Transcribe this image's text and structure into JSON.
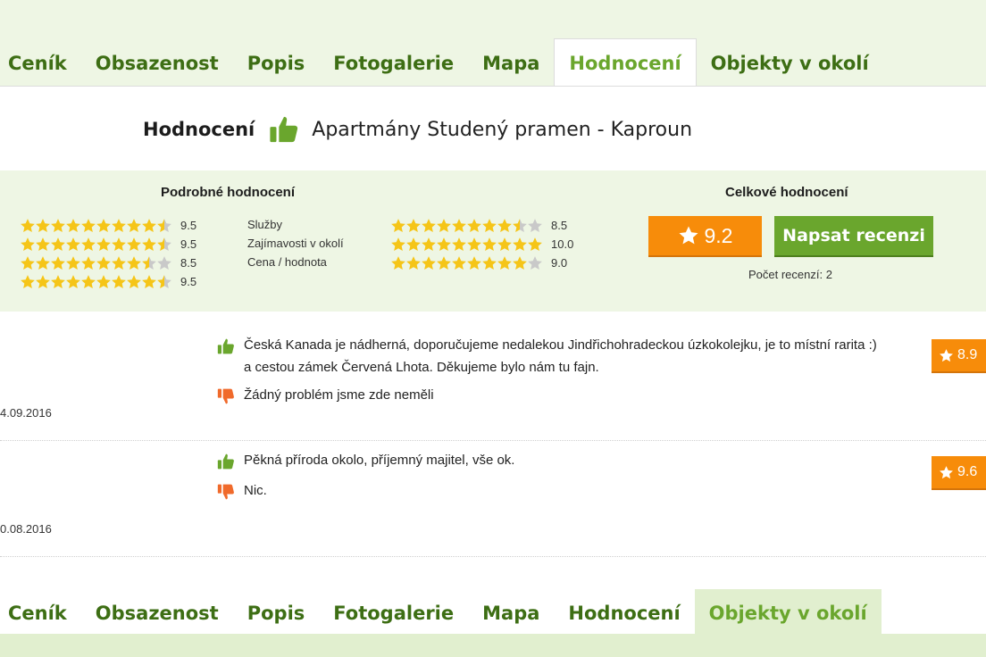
{
  "nav_top": {
    "tabs": [
      "Ceník",
      "Obsazenost",
      "Popis",
      "Fotogalerie",
      "Mapa",
      "Hodnocení",
      "Objekty v okolí"
    ],
    "active": "Hodnocení"
  },
  "nav_bottom": {
    "tabs": [
      "Ceník",
      "Obsazenost",
      "Popis",
      "Fotogalerie",
      "Mapa",
      "Hodnocení",
      "Objekty v okolí"
    ],
    "active": "Objekty v okolí"
  },
  "heading": {
    "label": "Hodnocení",
    "icon": "thumbs-up-icon",
    "property_name": "Apartmány Studený pramen - Kaproun"
  },
  "detailed": {
    "title": "Podrobné hodnocení",
    "left_ratings": [
      {
        "value": "9.5",
        "fraction": 0.95
      },
      {
        "value": "9.5",
        "fraction": 0.95
      },
      {
        "value": "8.5",
        "fraction": 0.85
      },
      {
        "value": "9.5",
        "fraction": 0.95
      }
    ],
    "categories": [
      "Služby",
      "Zajímavosti v okolí",
      "Cena / hodnota"
    ],
    "right_ratings": [
      {
        "value": "8.5",
        "fraction": 0.85
      },
      {
        "value": "10.0",
        "fraction": 1.0
      },
      {
        "value": "9.0",
        "fraction": 0.9
      }
    ]
  },
  "overall": {
    "title": "Celkové hodnocení",
    "score": "9.2",
    "write_review_label": "Napsat recenzi",
    "review_count_text": "Počet recenzí: 2"
  },
  "reviews": [
    {
      "positive_line1": "Česká Kanada je nádherná, doporučujeme nedalekou Jindřichohradeckou úzkokolejku, je to místní rarita :)",
      "positive_line2": "a cestou zámek Červená Lhota. Děkujeme bylo nám tu fajn.",
      "negative": "Žádný problém jsme zde neměli",
      "date": "4.09.2016",
      "score": "8.9"
    },
    {
      "positive_line1": "Pěkná příroda okolo, příjemný majitel, vše ok.",
      "positive_line2": "",
      "negative": "Nic.",
      "date": "0.08.2016",
      "score": "9.6"
    }
  ],
  "colors": {
    "tab_text": "#3d6e14",
    "accent_green": "#6aa62d",
    "orange": "#f78c0a",
    "panel_bg": "#eef6e4",
    "star_gold": "#f5c518",
    "star_empty": "#c9c9c9",
    "thumb_down": "#f06a2b"
  }
}
